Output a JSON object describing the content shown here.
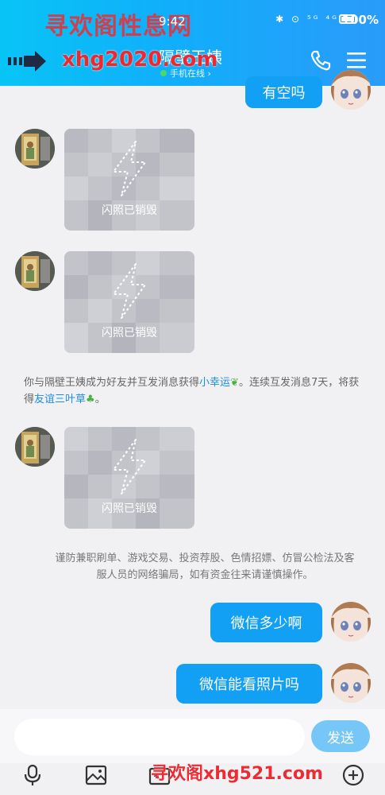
{
  "status": {
    "time": "9:42",
    "battery": "100%",
    "icons": "✱ ⊙ ⁵ᴳ ⁴ᴳ"
  },
  "header": {
    "title": "隔壁王姨",
    "subtitle": "手机在线 ›"
  },
  "watermarks": {
    "top_cn": "寻欢阁性息网",
    "top_url": "xhg2020.com",
    "bottom": "寻欢阁xhg521.com"
  },
  "messages": {
    "top_bubble": "有空吗",
    "flash_label": "闪照已销毁",
    "friend_note": {
      "prefix": "你与隔壁王姨成为好友并互发消息获得",
      "link1": "小幸运",
      "middle": "。连续互发消息7天，将获得",
      "link2": "友谊三叶草",
      "suffix": "。"
    },
    "warning": "谨防兼职刷单、游戏交易、投资荐股、色情招嫖、仿冒公检法及客服人员的网络骗局，如有资金往来请谨慎操作。",
    "out1": "微信多少啊",
    "out2": "微信能看照片吗"
  },
  "input": {
    "placeholder": "",
    "send": "发送"
  },
  "icons": [
    "back-arrow-icon",
    "phone-icon",
    "menu-icon",
    "lightning-icon",
    "mic-icon",
    "image-icon",
    "camera-icon",
    "add-icon"
  ],
  "colors": {
    "header": "#11aefb",
    "bubble": "#12a0f5",
    "link": "#1a8ee6",
    "send": "#77c6f8"
  }
}
